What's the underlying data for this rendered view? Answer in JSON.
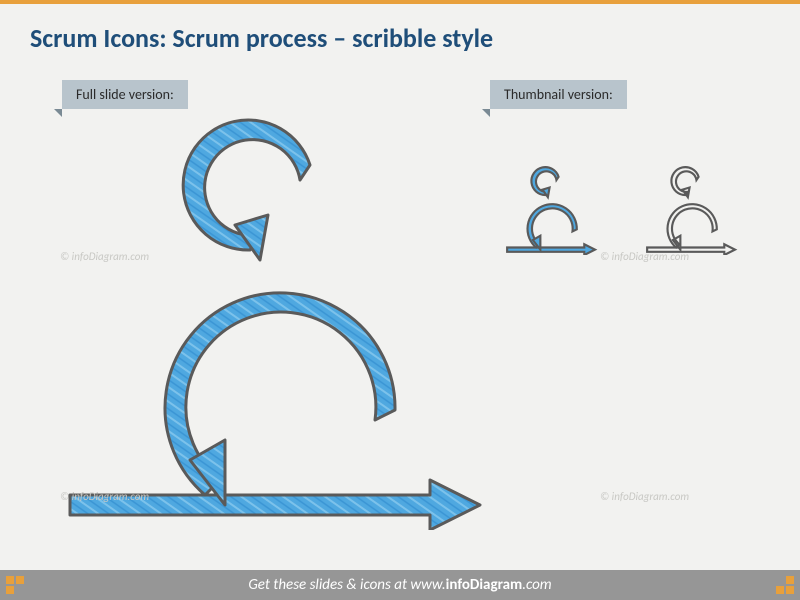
{
  "title": "Scrum Icons: Scrum process – scribble style",
  "labels": {
    "full": "Full slide version:",
    "thumb": "Thumbnail version:"
  },
  "watermark": "© infoDiagram.com",
  "footer": {
    "prefix": "Get these slides & icons at ",
    "brand_bold": "infoDiagram",
    "brand_suffix": ".com",
    "prefix_www": "www."
  },
  "colors": {
    "accent_blue": "#4fa8e0",
    "outline": "#5a5a5a",
    "orange": "#e8a03c",
    "footer_gray": "#969696",
    "title_blue": "#1f4e79",
    "tag_gray": "#b8c4cc"
  }
}
